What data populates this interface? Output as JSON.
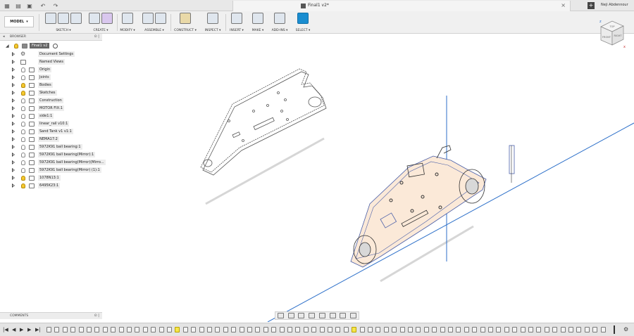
{
  "titlebar": {
    "document_title": "Final1 v2*",
    "user_name": "Neji Abdennour",
    "close_tab_glyph": "×",
    "new_tab_glyph": "+"
  },
  "toolbar": {
    "workspace": "MODEL",
    "groups": [
      {
        "label": "SKETCH ▾"
      },
      {
        "label": "CREATE ▾"
      },
      {
        "label": "MODIFY ▾"
      },
      {
        "label": "ASSEMBLE ▾"
      },
      {
        "label": "CONSTRUCT ▾"
      },
      {
        "label": "INSPECT ▾"
      },
      {
        "label": "INSERT ▾"
      },
      {
        "label": "MAKE ▾"
      },
      {
        "label": "ADD-INS ▾"
      },
      {
        "label": "SELECT ▾"
      }
    ]
  },
  "browser": {
    "header": "BROWSER",
    "root": "Final1 v2",
    "items": [
      {
        "label": "Document Settings",
        "icon": "gear-icon",
        "bulb": false
      },
      {
        "label": "Named Views",
        "icon": "folder-icon",
        "bulb": false
      },
      {
        "label": "Origin",
        "icon": "folder-icon",
        "bulb": false
      },
      {
        "label": "Joints",
        "icon": "folder-icon",
        "bulb": false
      },
      {
        "label": "Bodies",
        "icon": "folder-icon",
        "bulb": true
      },
      {
        "label": "Sketches",
        "icon": "folder-icon",
        "bulb": true
      },
      {
        "label": "Construction",
        "icon": "folder-icon",
        "bulb": false
      },
      {
        "label": "MOTOR FIX:1",
        "icon": "component-icon",
        "bulb": false
      },
      {
        "label": "side1:1",
        "icon": "component-icon",
        "bulb": false
      },
      {
        "label": "linear_rail v10:1",
        "icon": "component-icon",
        "bulb": false
      },
      {
        "label": "Sand Tank v1 v1:1",
        "icon": "component-icon",
        "bulb": false
      },
      {
        "label": "NEMA17:2",
        "icon": "component-icon",
        "bulb": false
      },
      {
        "label": "5972K91 ball bearing:1",
        "icon": "component-icon",
        "bulb": false
      },
      {
        "label": "5972K91 ball bearing(Mirror):1",
        "icon": "component-icon",
        "bulb": false
      },
      {
        "label": "5972K91 ball bearing(Mirror)(Mirro...",
        "icon": "component-icon",
        "bulb": false
      },
      {
        "label": "5972K91 ball bearing(Mirror) (1):1",
        "icon": "component-icon",
        "bulb": false
      },
      {
        "label": "1078N13:1",
        "icon": "component-icon",
        "bulb": true
      },
      {
        "label": "6495K23:1",
        "icon": "component-icon",
        "bulb": true
      }
    ]
  },
  "comments": {
    "header": "COMMENTS"
  },
  "viewcube": {
    "top": "TOP",
    "front": "FRONT",
    "right": "RIGHT"
  },
  "timeline": {
    "controls": [
      "|◀",
      "◀",
      "▶",
      "▶",
      "▶|"
    ],
    "settings_glyph": "⚙"
  },
  "colors": {
    "selection_blue": "#1a8dd0",
    "axis_blue": "#2c6fc9",
    "body_fill": "#fbe9d8",
    "bulb_on": "#f4c82f"
  }
}
